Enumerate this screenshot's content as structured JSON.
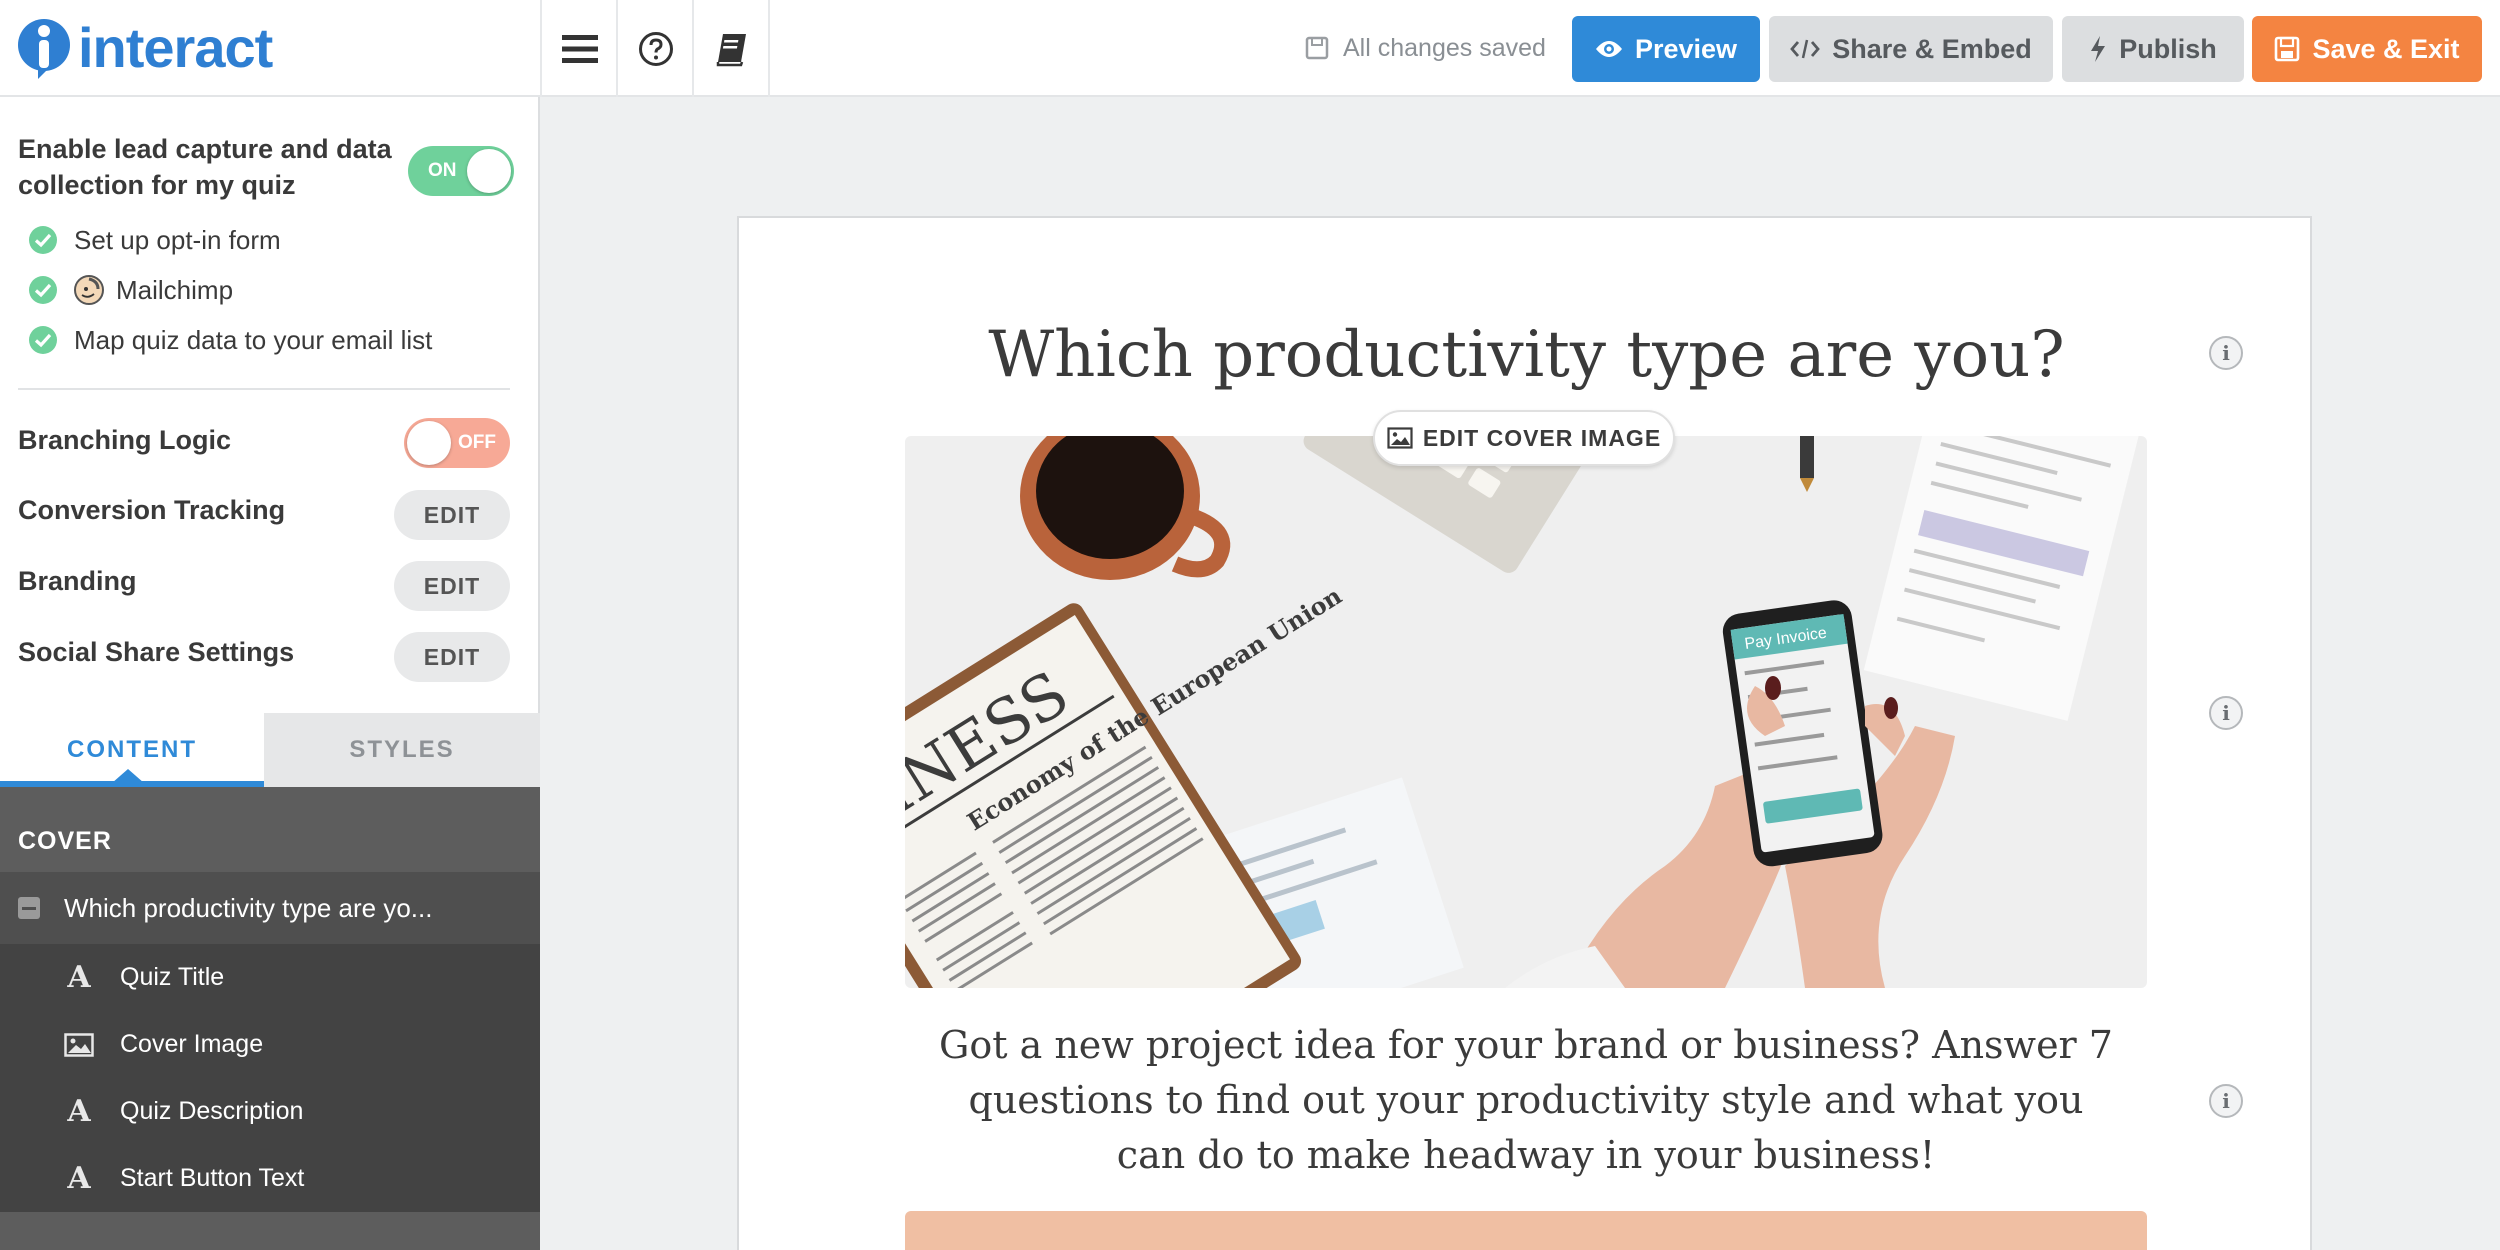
{
  "header": {
    "brand": "interact",
    "save_status": "All changes saved",
    "buttons": {
      "preview": "Preview",
      "share": "Share & Embed",
      "publish": "Publish",
      "save_exit": "Save & Exit"
    },
    "tool_icons": [
      "menu-icon",
      "help-icon",
      "book-icon"
    ]
  },
  "sidebar": {
    "lead_capture": {
      "label": "Enable lead capture and data collection for my quiz",
      "toggle": "ON",
      "enabled": true,
      "steps": [
        "Set up opt-in form",
        "Mailchimp",
        "Map quiz data to your email list"
      ]
    },
    "branching": {
      "label": "Branching Logic",
      "toggle": "OFF",
      "enabled": false
    },
    "settings": [
      {
        "label": "Conversion Tracking",
        "action": "EDIT"
      },
      {
        "label": "Branding",
        "action": "EDIT"
      },
      {
        "label": "Social Share Settings",
        "action": "EDIT"
      }
    ],
    "tabs": {
      "content": "CONTENT",
      "styles": "STYLES",
      "active": "content"
    },
    "tree": {
      "section": "COVER",
      "question": "Which productivity type are yo...",
      "items": [
        {
          "icon": "text-icon",
          "label": "Quiz Title"
        },
        {
          "icon": "image-icon",
          "label": "Cover Image"
        },
        {
          "icon": "text-icon",
          "label": "Quiz Description"
        },
        {
          "icon": "text-icon",
          "label": "Start Button Text"
        }
      ]
    }
  },
  "canvas": {
    "title": "Which productivity type are you?",
    "edit_cover": "EDIT COVER IMAGE",
    "description": "Got a new project idea for your brand or business? Answer 7 questions to find out your productivity style and what you can do to make headway in your business!",
    "cover_texts": {
      "newspaper": "SINESS",
      "headline": "Economy of the European Union",
      "phone": "Pay Invoice"
    }
  },
  "colors": {
    "primary": "#2f8ad8",
    "accent": "#f48441",
    "toggle_on": "#6fd19b",
    "toggle_off": "#f7a996",
    "start_button": "#f0bfa3"
  }
}
